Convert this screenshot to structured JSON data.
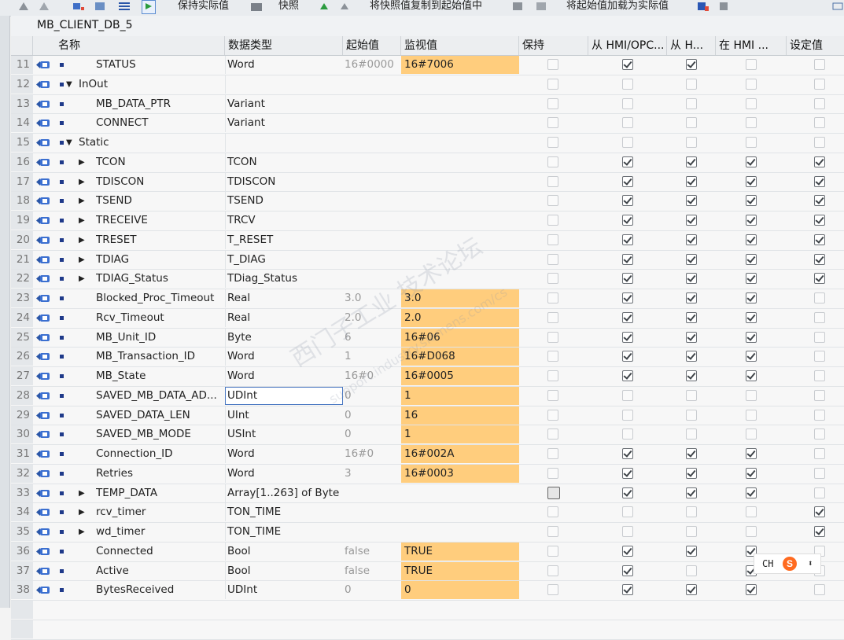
{
  "toolbar": {
    "keep_actual": "保持实际值",
    "snapshot": "快照",
    "copy_snapshot": "将快照值复制到起始值中",
    "load_start": "将起始值加载为实际值"
  },
  "db_title": "MB_CLIENT_DB_5",
  "columns": [
    "名称",
    "数据类型",
    "起始值",
    "监视值",
    "保持",
    "从 HMI/OPC...",
    "从 H...",
    "在 HMI ...",
    "设定值"
  ],
  "rows": [
    {
      "n": "11",
      "expander": "",
      "name": "STATUS",
      "type": "Word",
      "start": "16#0000",
      "monitor": "16#7006",
      "retain": false,
      "hmi1": true,
      "hmi2": true,
      "hmi3": false,
      "set": false,
      "indent": 1
    },
    {
      "n": "12",
      "expander": "▼",
      "name": "InOut",
      "type": "",
      "start": "",
      "monitor": "",
      "retain": false,
      "hmi1": false,
      "hmi2": false,
      "hmi3": false,
      "set": false,
      "indent": 0
    },
    {
      "n": "13",
      "expander": "",
      "name": "MB_DATA_PTR",
      "type": "Variant",
      "start": "",
      "monitor": "",
      "retain": false,
      "hmi1": false,
      "hmi2": false,
      "hmi3": false,
      "set": false,
      "indent": 1
    },
    {
      "n": "14",
      "expander": "",
      "name": "CONNECT",
      "type": "Variant",
      "start": "",
      "monitor": "",
      "retain": false,
      "hmi1": false,
      "hmi2": false,
      "hmi3": false,
      "set": false,
      "indent": 1
    },
    {
      "n": "15",
      "expander": "▼",
      "name": "Static",
      "type": "",
      "start": "",
      "monitor": "",
      "retain": false,
      "hmi1": false,
      "hmi2": false,
      "hmi3": false,
      "set": false,
      "indent": 0
    },
    {
      "n": "16",
      "expander": "▶",
      "name": "TCON",
      "type": "TCON",
      "start": "",
      "monitor": "",
      "retain": false,
      "hmi1": true,
      "hmi2": true,
      "hmi3": true,
      "set": true,
      "indent": 1
    },
    {
      "n": "17",
      "expander": "▶",
      "name": "TDISCON",
      "type": "TDISCON",
      "start": "",
      "monitor": "",
      "retain": false,
      "hmi1": true,
      "hmi2": true,
      "hmi3": true,
      "set": true,
      "indent": 1
    },
    {
      "n": "18",
      "expander": "▶",
      "name": "TSEND",
      "type": "TSEND",
      "start": "",
      "monitor": "",
      "retain": false,
      "hmi1": true,
      "hmi2": true,
      "hmi3": true,
      "set": true,
      "indent": 1
    },
    {
      "n": "19",
      "expander": "▶",
      "name": "TRECEIVE",
      "type": "TRCV",
      "start": "",
      "monitor": "",
      "retain": false,
      "hmi1": true,
      "hmi2": true,
      "hmi3": true,
      "set": true,
      "indent": 1
    },
    {
      "n": "20",
      "expander": "▶",
      "name": "TRESET",
      "type": "T_RESET",
      "start": "",
      "monitor": "",
      "retain": false,
      "hmi1": true,
      "hmi2": true,
      "hmi3": true,
      "set": true,
      "indent": 1
    },
    {
      "n": "21",
      "expander": "▶",
      "name": "TDIAG",
      "type": "T_DIAG",
      "start": "",
      "monitor": "",
      "retain": false,
      "hmi1": true,
      "hmi2": true,
      "hmi3": true,
      "set": true,
      "indent": 1
    },
    {
      "n": "22",
      "expander": "▶",
      "name": "TDIAG_Status",
      "type": "TDiag_Status",
      "start": "",
      "monitor": "",
      "retain": false,
      "hmi1": true,
      "hmi2": true,
      "hmi3": true,
      "set": true,
      "indent": 1
    },
    {
      "n": "23",
      "expander": "",
      "name": "Blocked_Proc_Timeout",
      "type": "Real",
      "start": "3.0",
      "monitor": "3.0",
      "retain": false,
      "hmi1": true,
      "hmi2": true,
      "hmi3": true,
      "set": false,
      "indent": 1
    },
    {
      "n": "24",
      "expander": "",
      "name": "Rcv_Timeout",
      "type": "Real",
      "start": "2.0",
      "monitor": "2.0",
      "retain": false,
      "hmi1": true,
      "hmi2": true,
      "hmi3": true,
      "set": false,
      "indent": 1
    },
    {
      "n": "25",
      "expander": "",
      "name": "MB_Unit_ID",
      "type": "Byte",
      "start": "6",
      "monitor": "16#06",
      "retain": false,
      "hmi1": true,
      "hmi2": true,
      "hmi3": true,
      "set": false,
      "indent": 1
    },
    {
      "n": "26",
      "expander": "",
      "name": "MB_Transaction_ID",
      "type": "Word",
      "start": "1",
      "monitor": "16#D068",
      "retain": false,
      "hmi1": true,
      "hmi2": true,
      "hmi3": true,
      "set": false,
      "indent": 1
    },
    {
      "n": "27",
      "expander": "",
      "name": "MB_State",
      "type": "Word",
      "start": "16#0",
      "monitor": "16#0005",
      "retain": false,
      "hmi1": true,
      "hmi2": true,
      "hmi3": true,
      "set": false,
      "indent": 1
    },
    {
      "n": "28",
      "expander": "",
      "name": "SAVED_MB_DATA_AD...",
      "type": "UDInt",
      "start": "0",
      "monitor": "1",
      "retain": false,
      "hmi1": false,
      "hmi2": false,
      "hmi3": false,
      "set": false,
      "indent": 1,
      "selected": true
    },
    {
      "n": "29",
      "expander": "",
      "name": "SAVED_DATA_LEN",
      "type": "UInt",
      "start": "0",
      "monitor": "16",
      "retain": false,
      "hmi1": false,
      "hmi2": false,
      "hmi3": false,
      "set": false,
      "indent": 1
    },
    {
      "n": "30",
      "expander": "",
      "name": "SAVED_MB_MODE",
      "type": "USInt",
      "start": "0",
      "monitor": "1",
      "retain": false,
      "hmi1": false,
      "hmi2": false,
      "hmi3": false,
      "set": false,
      "indent": 1
    },
    {
      "n": "31",
      "expander": "",
      "name": "Connection_ID",
      "type": "Word",
      "start": "16#0",
      "monitor": "16#002A",
      "retain": false,
      "hmi1": true,
      "hmi2": true,
      "hmi3": true,
      "set": false,
      "indent": 1
    },
    {
      "n": "32",
      "expander": "",
      "name": "Retries",
      "type": "Word",
      "start": "3",
      "monitor": "16#0003",
      "retain": false,
      "hmi1": true,
      "hmi2": true,
      "hmi3": true,
      "set": false,
      "indent": 1
    },
    {
      "n": "33",
      "expander": "▶",
      "name": "TEMP_DATA",
      "type": "Array[1..263] of Byte",
      "start": "",
      "monitor": "",
      "retain": false,
      "retain_focus": true,
      "hmi1": true,
      "hmi2": true,
      "hmi3": true,
      "set": false,
      "indent": 1
    },
    {
      "n": "34",
      "expander": "▶",
      "name": "rcv_timer",
      "type": "TON_TIME",
      "start": "",
      "monitor": "",
      "retain": false,
      "hmi1": false,
      "hmi2": false,
      "hmi3": false,
      "set": true,
      "indent": 1
    },
    {
      "n": "35",
      "expander": "▶",
      "name": "wd_timer",
      "type": "TON_TIME",
      "start": "",
      "monitor": "",
      "retain": false,
      "hmi1": false,
      "hmi2": false,
      "hmi3": false,
      "set": true,
      "indent": 1
    },
    {
      "n": "36",
      "expander": "",
      "name": "Connected",
      "type": "Bool",
      "start": "false",
      "monitor": "TRUE",
      "retain": false,
      "hmi1": true,
      "hmi2": true,
      "hmi3": true,
      "set": false,
      "indent": 1
    },
    {
      "n": "37",
      "expander": "",
      "name": "Active",
      "type": "Bool",
      "start": "false",
      "monitor": "TRUE",
      "retain": false,
      "hmi1": true,
      "hmi2": false,
      "hmi3": true,
      "set": false,
      "indent": 1
    },
    {
      "n": "38",
      "expander": "",
      "name": "BytesReceived",
      "type": "UDInt",
      "start": "0",
      "monitor": "0",
      "retain": false,
      "hmi1": true,
      "hmi2": true,
      "hmi3": true,
      "set": false,
      "indent": 1
    }
  ],
  "watermark": {
    "line1": "西门子工业 技术论坛",
    "line2": "support.industry.siemens.com/cs"
  },
  "ime": {
    "text": "CH",
    "logo": "S",
    "arrows": "⬍"
  }
}
